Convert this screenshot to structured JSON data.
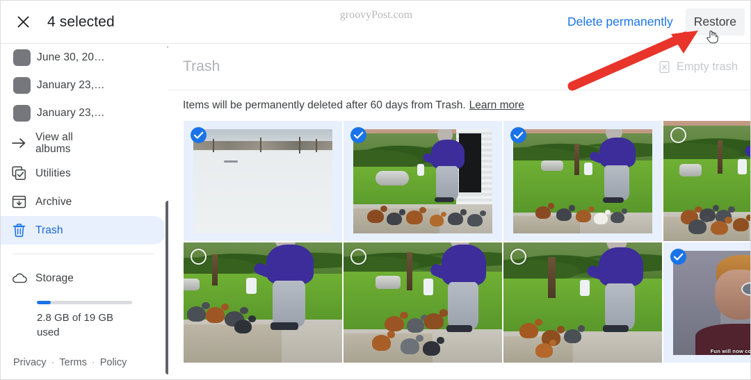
{
  "topbar": {
    "close_icon": "close-icon",
    "selected_label": "4 selected",
    "delete_permanently_label": "Delete permanently",
    "restore_label": "Restore",
    "watermark": "groovyPost.com"
  },
  "sidebar": {
    "albums": [
      {
        "label": "June 30, 20…",
        "icon": "album-thumbnail"
      },
      {
        "label": "January 23,…",
        "icon": "album-thumbnail"
      },
      {
        "label": "January 23,…",
        "icon": "album-thumbnail"
      }
    ],
    "view_all_albums_label": "View all\nalbums",
    "view_all_albums_line1": "View all",
    "view_all_albums_line2": "albums",
    "nav": [
      {
        "label": "Utilities",
        "icon": "utilities-icon",
        "active": false
      },
      {
        "label": "Archive",
        "icon": "archive-icon",
        "active": false
      },
      {
        "label": "Trash",
        "icon": "trash-icon",
        "active": true
      }
    ],
    "storage": {
      "label": "Storage",
      "icon": "cloud-icon",
      "usage_text": "2.8 GB of 19 GB used",
      "used_gb": 2.8,
      "total_gb": 19,
      "percent_used": 14.7,
      "bar_color": "#1a73e8"
    },
    "footer": {
      "privacy": "Privacy",
      "terms": "Terms",
      "policy": "Policy",
      "separator": "·"
    }
  },
  "main": {
    "title": "Trash",
    "empty_trash_label": "Empty trash",
    "empty_trash_icon": "empty-trash-icon",
    "empty_trash_disabled": true,
    "notice_text": "Items will be permanently deleted after 60 days from Trash.",
    "notice_link": "Learn more",
    "photos": [
      {
        "id": 1,
        "selected": true,
        "scene": "snow-field",
        "alt": "Snow covered field"
      },
      {
        "id": 2,
        "selected": true,
        "scene": "yard-shed-chickens",
        "alt": "Person feeding chickens by shed"
      },
      {
        "id": 3,
        "selected": true,
        "scene": "yard-lawn-chickens",
        "alt": "Person bending to feed chickens on lawn"
      },
      {
        "id": 4,
        "selected": false,
        "scene": "yard-walk-chickens",
        "alt": "Person feeding chickens near walkway"
      },
      {
        "id": 5,
        "selected": false,
        "scene": "yard-gravel-chickens",
        "alt": "Chickens on gravel driveway"
      },
      {
        "id": 6,
        "selected": false,
        "scene": "yard-wide-chickens",
        "alt": "Wide view of chickens being fed"
      },
      {
        "id": 7,
        "selected": false,
        "scene": "yard-tree-chickens",
        "alt": "Chickens near tree in yard"
      },
      {
        "id": 8,
        "selected": true,
        "scene": "meme-portrait",
        "alt": "Meme portrait",
        "caption": "Fun will now commence."
      }
    ]
  },
  "annotation": {
    "arrow_color": "#e8342a",
    "arrow_target": "restore-button",
    "cursor_icon": "hand-pointer-cursor"
  },
  "colors": {
    "accent_blue": "#1a73e8",
    "selected_tile_bg": "#e8f0fe",
    "text_primary": "#3c4043",
    "text_muted": "#aeb2b7",
    "arrow_red": "#e8342a"
  }
}
